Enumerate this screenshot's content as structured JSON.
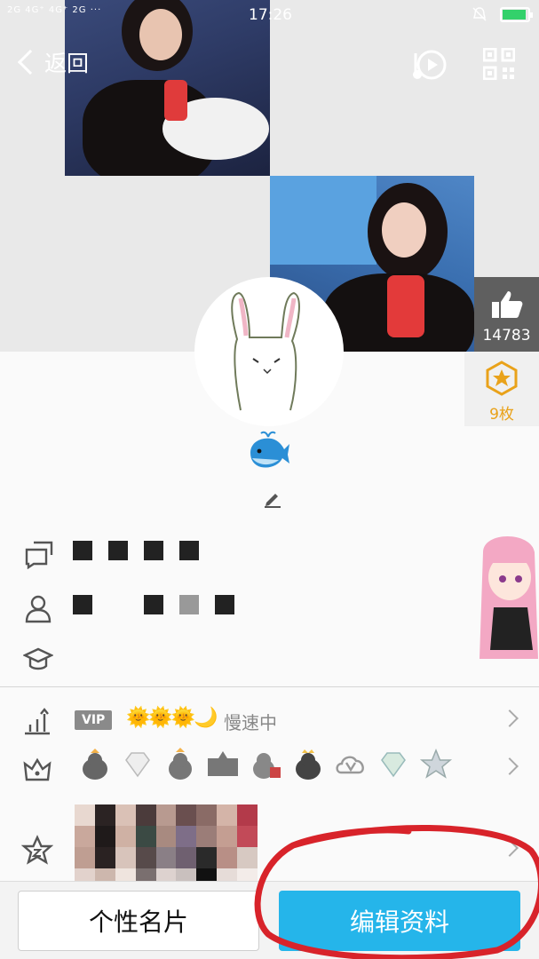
{
  "status_bar": {
    "signal_text": "2G 4G⁺ 4G⁺ 2G ···",
    "time": "17:26"
  },
  "header": {
    "back_label": "返回",
    "icons": [
      "music-icon",
      "qr-code-icon"
    ]
  },
  "profile": {
    "likes": "14783",
    "medals": "9枚",
    "medal_color": "#e9a21a",
    "icons": [
      "thumbs-up-icon",
      "star-medal-icon",
      "whale-icon",
      "pen-icon"
    ]
  },
  "info_rows": [
    {
      "icon": "chat-bubbles-icon"
    },
    {
      "icon": "person-icon"
    },
    {
      "icon": "graduation-cap-icon"
    }
  ],
  "level_row": {
    "vip_label": "VIP",
    "level_icons": "🌞🌞🌞🌙",
    "status_text": "慢速中"
  },
  "privilege_row": {
    "icons": [
      "crown-icon",
      "penguin-badge-icon",
      "diamond-badge-icon",
      "penguin-badge-icon",
      "penguin-badge-icon",
      "penguin-badge-icon",
      "penguin-badge-icon",
      "cloud-v-badge-icon",
      "diamond-badge-icon",
      "star-badge-icon"
    ]
  },
  "bottom_bar": {
    "card_label": "个性名片",
    "edit_label": "编辑资料",
    "accent_color": "#25b5ea"
  }
}
